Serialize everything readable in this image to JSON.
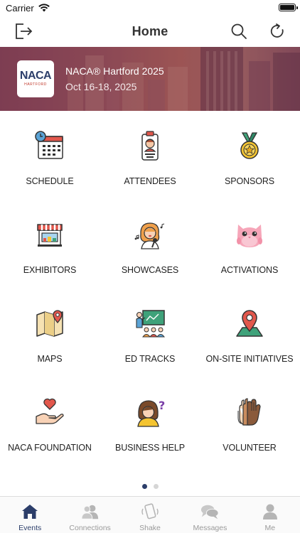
{
  "status_bar": {
    "carrier": "Carrier"
  },
  "nav": {
    "title": "Home"
  },
  "event": {
    "logo_text": "NACA",
    "logo_subtext": "HARTFORD",
    "name": "NACA® Hartford 2025",
    "dates": "Oct 16-18, 2025"
  },
  "tiles": [
    {
      "label": "SCHEDULE",
      "icon": "calendar-clock-icon"
    },
    {
      "label": "ATTENDEES",
      "icon": "id-badge-icon"
    },
    {
      "label": "SPONSORS",
      "icon": "medal-icon"
    },
    {
      "label": "EXHIBITORS",
      "icon": "storefront-icon"
    },
    {
      "label": "SHOWCASES",
      "icon": "singer-icon"
    },
    {
      "label": "ACTIVATIONS",
      "icon": "owl-plush-icon"
    },
    {
      "label": "MAPS",
      "icon": "folded-map-icon"
    },
    {
      "label": "ED TRACKS",
      "icon": "presentation-board-icon"
    },
    {
      "label": "ON-SITE INITIATIVES",
      "icon": "location-pin-icon"
    },
    {
      "label": "NACA FOUNDATION",
      "icon": "hand-heart-icon"
    },
    {
      "label": "BUSINESS HELP",
      "icon": "question-person-icon"
    },
    {
      "label": "VOLUNTEER",
      "icon": "raised-hands-icon"
    }
  ],
  "pagination": {
    "active": 1,
    "total": 2
  },
  "tab_bar": {
    "tabs": [
      {
        "label": "Events",
        "icon": "house-icon",
        "active": true
      },
      {
        "label": "Connections",
        "icon": "people-icon",
        "active": false
      },
      {
        "label": "Shake",
        "icon": "shake-phone-icon",
        "active": false
      },
      {
        "label": "Messages",
        "icon": "chat-bubbles-icon",
        "active": false
      },
      {
        "label": "Me",
        "icon": "person-icon",
        "active": false
      }
    ]
  },
  "colors": {
    "accent": "#2c3e6a",
    "banner": "#8d4a56",
    "inactive_tab": "#9a9a9a"
  }
}
